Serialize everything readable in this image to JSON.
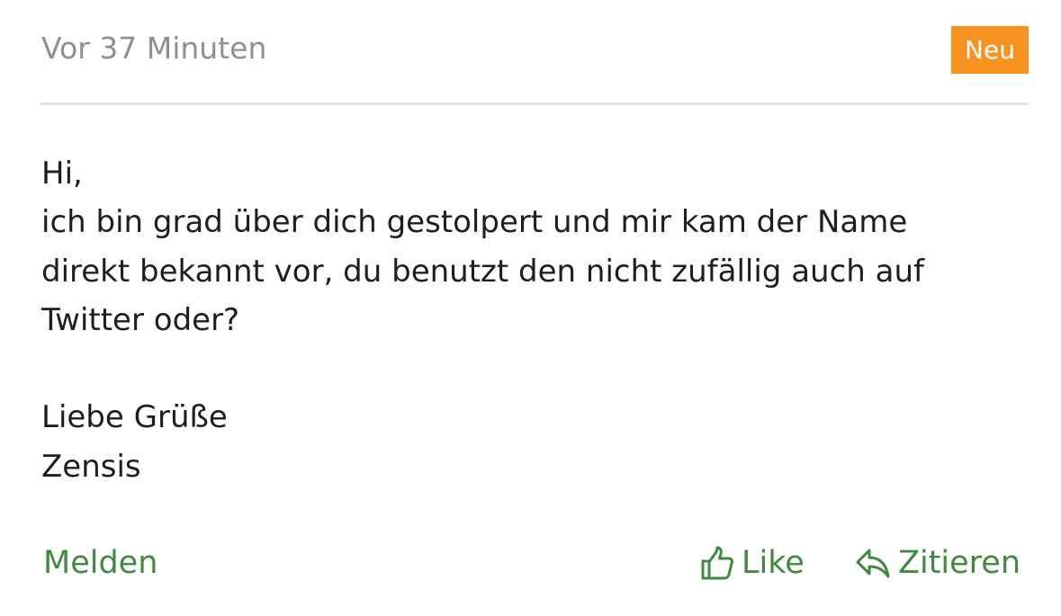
{
  "post": {
    "timestamp": "Vor 37 Minuten",
    "badge": "Neu",
    "message_lines": [
      "Hi,",
      "ich bin grad über dich gestolpert und mir kam der Name",
      "direkt bekannt vor, du benutzt den nicht zufällig auch auf",
      "Twitter oder?",
      "",
      "Liebe Grüße",
      "Zensis"
    ]
  },
  "actions": {
    "report_label": "Melden",
    "like_label": "Like",
    "quote_label": "Zitieren"
  },
  "icons": {
    "like": "thumbs-up-icon",
    "quote": "reply-arrow-icon"
  },
  "colors": {
    "accent_green": "#3f8a3f",
    "badge_orange": "#f7931e",
    "timestamp_gray": "#8f8f8f",
    "text": "#1e1e1e"
  }
}
